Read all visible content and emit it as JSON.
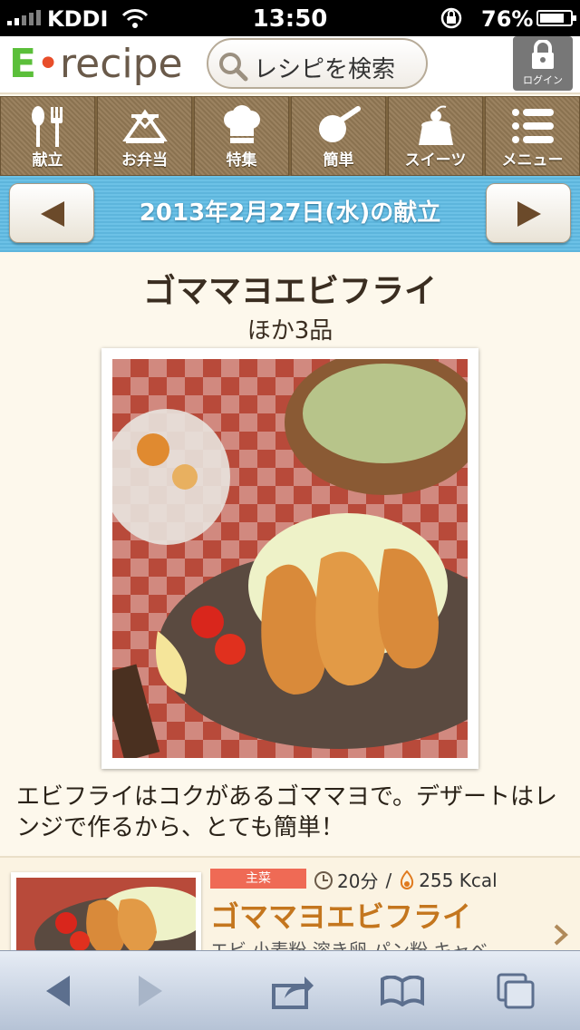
{
  "status": {
    "carrier": "KDDI",
    "time": "13:50",
    "battery": "76%"
  },
  "header": {
    "logo_e": "E",
    "logo_dot": "•",
    "logo_rest": "recipe",
    "search_label": "レシピを検索",
    "login_label": "ログイン"
  },
  "nav": [
    {
      "label": "献立",
      "icon": "spoon-fork-icon"
    },
    {
      "label": "お弁当",
      "icon": "bento-icon"
    },
    {
      "label": "特集",
      "icon": "chef-hat-icon"
    },
    {
      "label": "簡単",
      "icon": "frying-pan-icon"
    },
    {
      "label": "スイーツ",
      "icon": "cake-icon"
    },
    {
      "label": "メニュー",
      "icon": "menu-list-icon"
    }
  ],
  "date_bar": {
    "label": "2013年2月27日(水)の献立"
  },
  "main": {
    "title": "ゴママヨエビフライ",
    "subtitle": "ほか3品",
    "description": "エビフライはコクがあるゴママヨで。デザートはレンジで作るから、とても簡単！"
  },
  "recipe": {
    "tag": "主菜",
    "time": "20分",
    "separator": "/",
    "calories": "255 Kcal",
    "title": "ゴママヨエビフライ",
    "ingredients": "エビ 小麦粉 溶き卵 パン粉 キャベ"
  },
  "colors": {
    "accent": "#c4761e",
    "tag": "#ef6a55",
    "date_bar": "#6cc1e6",
    "nav": "#927a58"
  }
}
